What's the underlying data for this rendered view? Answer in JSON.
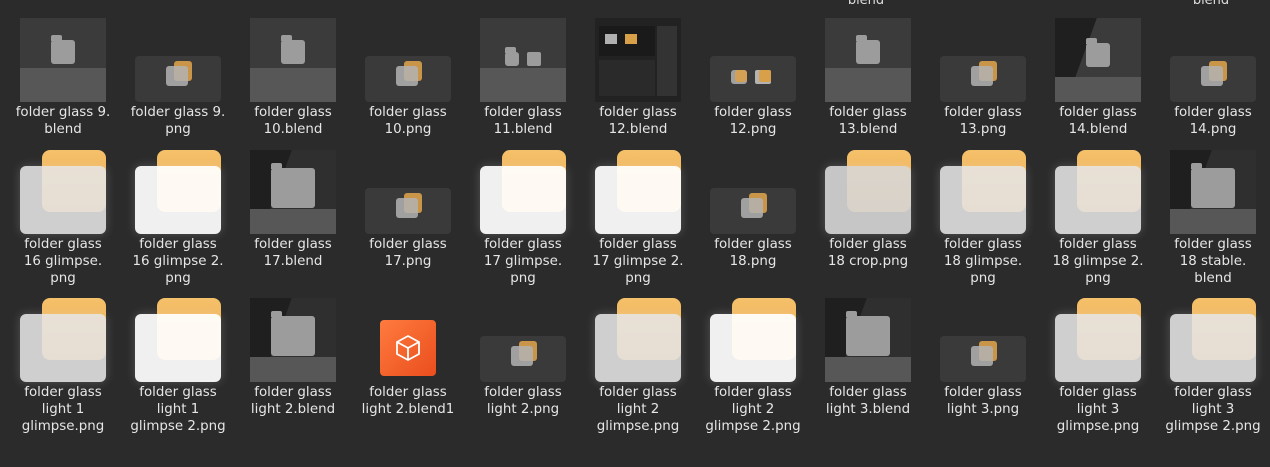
{
  "cutoff_labels": [
    "blend",
    "blend"
  ],
  "rows": [
    [
      {
        "label": "folder glass 9.\nblend",
        "thumb": "scene",
        "icon": "blend-scene-icon"
      },
      {
        "label": "folder glass 9.\npng",
        "thumb": "small",
        "icon": "png-thumbnail-icon"
      },
      {
        "label": "folder glass\n10.blend",
        "thumb": "scene",
        "icon": "blend-scene-icon"
      },
      {
        "label": "folder glass\n10.png",
        "thumb": "small",
        "icon": "png-thumbnail-icon"
      },
      {
        "label": "folder glass\n11.blend",
        "thumb": "scene-two",
        "icon": "blend-scene-icon"
      },
      {
        "label": "folder glass\n12.blend",
        "thumb": "screen",
        "icon": "blend-screenshot-icon"
      },
      {
        "label": "folder glass\n12.png",
        "thumb": "small-pair",
        "icon": "png-thumbnail-icon"
      },
      {
        "label": "folder glass\n13.blend",
        "thumb": "scene",
        "icon": "blend-scene-icon"
      },
      {
        "label": "folder glass\n13.png",
        "thumb": "small",
        "icon": "png-thumbnail-icon"
      },
      {
        "label": "folder glass\n14.blend",
        "thumb": "scene-wedge",
        "icon": "blend-scene-icon"
      },
      {
        "label": "folder glass\n14.png",
        "thumb": "small",
        "icon": "png-thumbnail-icon"
      }
    ],
    [
      {
        "label": "folder glass\n16 glimpse.\npng",
        "thumb": "glimpse",
        "icon": "png-thumbnail-icon"
      },
      {
        "label": "folder glass\n16 glimpse 2.\npng",
        "thumb": "glimpse-bright",
        "icon": "png-thumbnail-icon"
      },
      {
        "label": "folder glass\n17.blend",
        "thumb": "scene-dark",
        "icon": "blend-scene-icon"
      },
      {
        "label": "folder glass\n17.png",
        "thumb": "small",
        "icon": "png-thumbnail-icon"
      },
      {
        "label": "folder glass\n17 glimpse.\npng",
        "thumb": "glimpse-bright",
        "icon": "png-thumbnail-icon"
      },
      {
        "label": "folder glass\n17 glimpse 2.\npng",
        "thumb": "glimpse-bright",
        "icon": "png-thumbnail-icon"
      },
      {
        "label": "folder glass\n18.png",
        "thumb": "small",
        "icon": "png-thumbnail-icon"
      },
      {
        "label": "folder glass\n18 crop.png",
        "thumb": "glimpse-crop",
        "icon": "png-thumbnail-icon"
      },
      {
        "label": "folder glass\n18 glimpse.\npng",
        "thumb": "glimpse",
        "icon": "png-thumbnail-icon"
      },
      {
        "label": "folder glass\n18 glimpse 2.\npng",
        "thumb": "glimpse",
        "icon": "png-thumbnail-icon"
      },
      {
        "label": "folder glass\n18 stable.\nblend",
        "thumb": "scene-dark",
        "icon": "blend-scene-icon"
      }
    ],
    [
      {
        "label": "folder glass\nlight 1\nglimpse.png",
        "thumb": "glimpse",
        "icon": "png-thumbnail-icon"
      },
      {
        "label": "folder glass\nlight 1\nglimpse 2.png",
        "thumb": "glimpse-bright",
        "icon": "png-thumbnail-icon"
      },
      {
        "label": "folder glass\nlight 2.blend",
        "thumb": "scene-dark",
        "icon": "blend-scene-icon"
      },
      {
        "label": "folder glass\nlight 2.blend1",
        "thumb": "app",
        "icon": "blender-file-icon"
      },
      {
        "label": "folder glass\nlight 2.png",
        "thumb": "small",
        "icon": "png-thumbnail-icon"
      },
      {
        "label": "folder glass\nlight 2\nglimpse.png",
        "thumb": "glimpse",
        "icon": "png-thumbnail-icon"
      },
      {
        "label": "folder glass\nlight 2\nglimpse 2.png",
        "thumb": "glimpse-bright",
        "icon": "png-thumbnail-icon"
      },
      {
        "label": "folder glass\nlight 3.blend",
        "thumb": "scene-dark",
        "icon": "blend-scene-icon"
      },
      {
        "label": "folder glass\nlight 3.png",
        "thumb": "small",
        "icon": "png-thumbnail-icon"
      },
      {
        "label": "folder glass\nlight 3\nglimpse.png",
        "thumb": "glimpse",
        "icon": "png-thumbnail-icon"
      },
      {
        "label": "folder glass\nlight 3\nglimpse 2.png",
        "thumb": "glimpse",
        "icon": "png-thumbnail-icon"
      }
    ]
  ],
  "colors": {
    "background": "#2b2b2b",
    "accent_orange": "#e8a24c",
    "blender_orange": "#ff7b3e"
  }
}
